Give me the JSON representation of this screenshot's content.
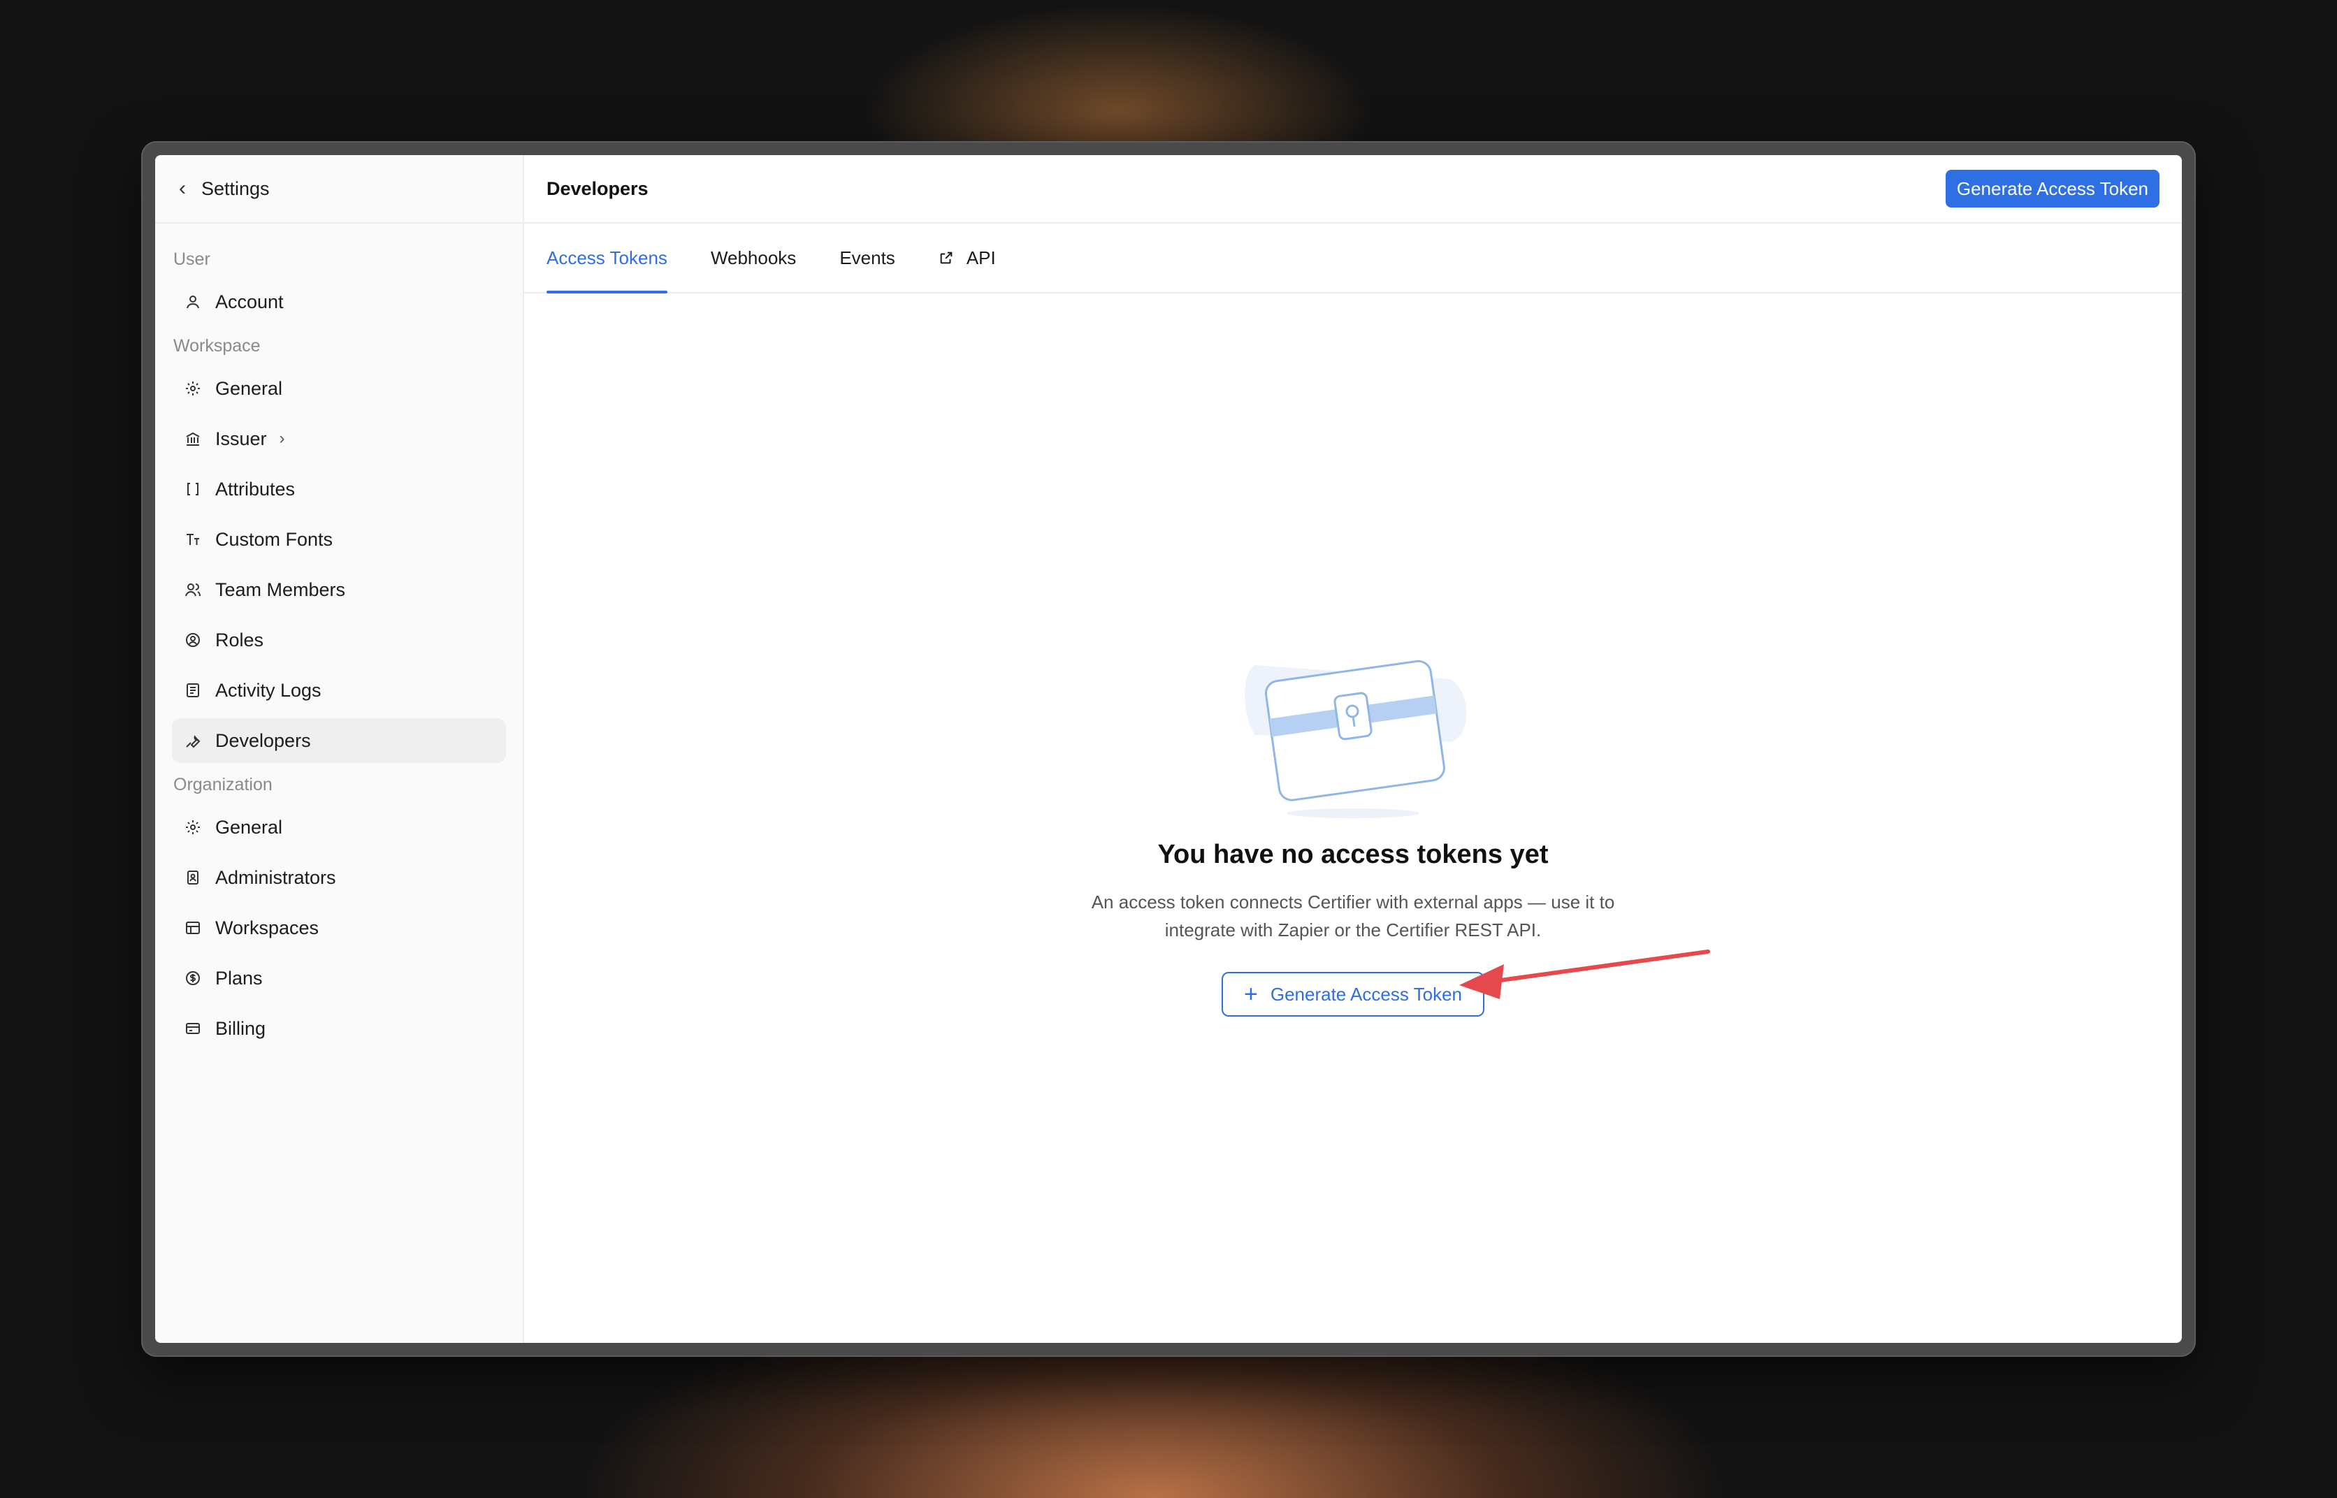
{
  "sidebar": {
    "back_label": "Settings",
    "sections": [
      {
        "label": "User",
        "items": [
          {
            "label": "Account",
            "icon": "user-icon"
          }
        ]
      },
      {
        "label": "Workspace",
        "items": [
          {
            "label": "General",
            "icon": "gear-icon"
          },
          {
            "label": "Issuer",
            "icon": "bank-icon"
          },
          {
            "label": "Attributes",
            "icon": "brackets-icon"
          },
          {
            "label": "Custom Fonts",
            "icon": "text-size-icon"
          },
          {
            "label": "Team Members",
            "icon": "users-icon"
          },
          {
            "label": "Roles",
            "icon": "role-icon"
          },
          {
            "label": "Activity Logs",
            "icon": "log-icon"
          },
          {
            "label": "Developers",
            "icon": "wrench-icon",
            "active": true
          }
        ]
      },
      {
        "label": "Organization",
        "items": [
          {
            "label": "General",
            "icon": "gear-icon"
          },
          {
            "label": "Administrators",
            "icon": "admin-badge-icon"
          },
          {
            "label": "Workspaces",
            "icon": "layout-icon"
          },
          {
            "label": "Plans",
            "icon": "dollar-circle-icon"
          },
          {
            "label": "Billing",
            "icon": "credit-card-icon"
          }
        ]
      }
    ]
  },
  "header": {
    "title": "Developers",
    "primary_button": "Generate Access Token"
  },
  "tabs": [
    {
      "label": "Access Tokens",
      "active": true
    },
    {
      "label": "Webhooks"
    },
    {
      "label": "Events"
    },
    {
      "label": "API",
      "icon": "external-link-icon"
    }
  ],
  "empty_state": {
    "title": "You have no access tokens yet",
    "description_line1": "An access token connects Certifier with external apps — use it to",
    "description_line2": "integrate with Zapier or the Certifier REST API.",
    "button_label": "Generate Access Token",
    "illustration": "locked-chest-icon"
  },
  "colors": {
    "accent": "#2f6fe4",
    "annotation_arrow": "#e5484d"
  }
}
